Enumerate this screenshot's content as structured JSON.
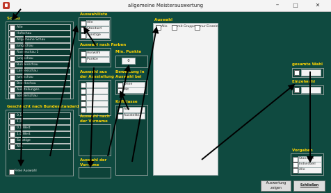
{
  "window": {
    "title": "allgemeine Meisterauswertung",
    "minimize": "–",
    "maximize": "□",
    "close": "✕"
  },
  "schau": {
    "label": "Schau",
    "items": [
      "Alle",
      "Hofschau",
      "Allgemeine Schau",
      "Jungschau",
      "Rasseschau 1",
      "Jungschau",
      "Bundesschau",
      "Landesschau",
      "Jungschau",
      "Bezirkschau",
      "Ausstellungen",
      "Sonderschau"
    ]
  },
  "geschlecht": {
    "label": "Geschlecht nach Bundesstandard",
    "items": [
      "0,1",
      "1,0",
      "0,1 Wert",
      "1,0 Wert",
      "Sonstige",
      "Alle"
    ],
    "footer": "Freie Auswahl"
  },
  "auswahlliste": {
    "label": "Auswahlliste",
    "items": [
      "Alle",
      "Standard",
      "Sonstige"
    ]
  },
  "auswahl_farbe": {
    "label": "Auswahl nach Farben",
    "items": [
      "Auswahl",
      "Punkte"
    ]
  },
  "auswahl_ausstellung": {
    "label": "Auswahl aus der Ausstellung"
  },
  "auswahl_bei": {
    "label": "Auswahl nach der Vorname"
  },
  "auswahl_bei2": {
    "label": "Auswahl der Vorname"
  },
  "min_punkte": {
    "label": "Min. Punkte",
    "value": "0"
  },
  "bewertung": {
    "label": "Bewertung in Auswahl bei",
    "items": [
      "Ohne",
      "Mit"
    ]
  },
  "kafiklasse": {
    "label": "Kafiklasse",
    "items": [
      "Alle",
      "Ausstellkl."
    ]
  },
  "auswahl": {
    "label": "Auswahl",
    "tabs": [
      "Alle",
      "mit Gruppen",
      "nur Einzeln"
    ]
  },
  "gesamt_wahl": {
    "label": "gesamte Wahl"
  },
  "einzelwahl": {
    "label": "Einzelwahl"
  },
  "vorlagen": {
    "label": "Vorgaben",
    "items": [
      "Standard",
      "Individuell",
      "Alle"
    ]
  },
  "buttons": {
    "auswertung": "Auswertung zeigen",
    "schliessen": "Schließen"
  }
}
